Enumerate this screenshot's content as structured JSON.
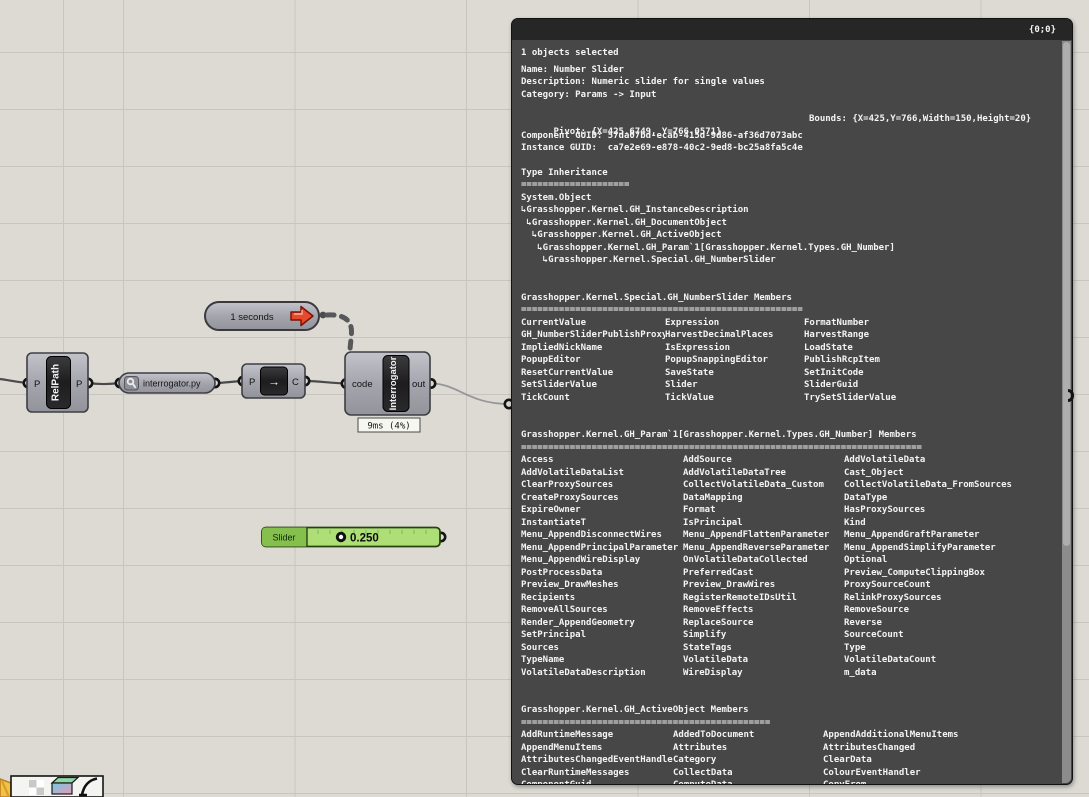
{
  "canvas": {
    "components": {
      "relpath": {
        "label": "RelPath",
        "input": "P",
        "output": "P"
      },
      "py_capsule": {
        "label": "interrogator.py"
      },
      "ptoc": {
        "input": "P",
        "output": "C",
        "arrow": "→"
      },
      "interrogator": {
        "label": "Interrogator",
        "input": "code",
        "output": "out",
        "runtime": "9ms (4%)"
      },
      "timer": {
        "label": "1 seconds"
      },
      "slider": {
        "label": "Slider",
        "value": "0.250"
      }
    },
    "colors": {
      "canvas_bg": "#dcdad3",
      "grid_line": "#c7c5be",
      "component_gray": "#a9a9b1",
      "slider_green": "#aede76",
      "slider_label_green": "#85c04f",
      "timer_arrow_red": "#e8492c",
      "panel_bg": "#474747",
      "panel_header_bg": "#262626"
    }
  },
  "panel": {
    "path_badge": "{0;0}",
    "selected": "1 objects selected",
    "name": "Name: Number Slider",
    "description": "Description: Numeric slider for single values",
    "category": "Category: Params -> Input",
    "pivot": "Pivot: {X=425.6749, Y=766.0571}",
    "bounds": "Bounds: {X=425,Y=766,Width=150,Height=20}",
    "component_guid": "Component GUID: 57da07bd-ecab-415d-9d86-af36d7073abc",
    "instance_guid": "Instance GUID:  ca7e2e69-e878-40c2-9ed8-bc25a8fa5c4e",
    "inheritance": {
      "title": "Type Inheritance",
      "sep": "====================",
      "lines": [
        "System.Object",
        "↳Grasshopper.Kernel.GH_InstanceDescription",
        " ↳Grasshopper.Kernel.GH_DocumentObject",
        "  ↳Grasshopper.Kernel.GH_ActiveObject",
        "   ↳Grasshopper.Kernel.GH_Param`1[Grasshopper.Kernel.Types.GH_Number]",
        "    ↳Grasshopper.Kernel.Special.GH_NumberSlider"
      ]
    },
    "sections": [
      {
        "title": "Grasshopper.Kernel.Special.GH_NumberSlider Members",
        "sep": "====================================================",
        "rows": [
          [
            "CurrentValue",
            "Expression",
            "FormatNumber"
          ],
          [
            "GH_NumberSliderPublishProxy",
            "HarvestDecimalPlaces",
            "HarvestRange"
          ],
          [
            "ImpliedNickName",
            "IsExpression",
            "LoadState"
          ],
          [
            "PopupEditor",
            "PopupSnappingEditor",
            "PublishRcpItem"
          ],
          [
            "ResetCurrentValue",
            "SaveState",
            "SetInitCode"
          ],
          [
            "SetSliderValue",
            "Slider",
            "SliderGuid"
          ],
          [
            "TickCount",
            "TickValue",
            "TrySetSliderValue"
          ]
        ]
      },
      {
        "title": "Grasshopper.Kernel.GH_Param`1[Grasshopper.Kernel.Types.GH_Number] Members",
        "sep": "==========================================================================",
        "rows": [
          [
            "Access",
            "AddSource",
            "AddVolatileData"
          ],
          [
            "AddVolatileDataList",
            "AddVolatileDataTree",
            "Cast_Object"
          ],
          [
            "ClearProxySources",
            "CollectVolatileData_Custom",
            "CollectVolatileData_FromSources"
          ],
          [
            "CreateProxySources",
            "DataMapping",
            "DataType"
          ],
          [
            "ExpireOwner",
            "Format",
            "HasProxySources"
          ],
          [
            "InstantiateT",
            "IsPrincipal",
            "Kind"
          ],
          [
            "Menu_AppendDisconnectWires",
            "Menu_AppendFlattenParameter",
            "Menu_AppendGraftParameter"
          ],
          [
            "Menu_AppendPrincipalParameter",
            "Menu_AppendReverseParameter",
            "Menu_AppendSimplifyParameter"
          ],
          [
            "Menu_AppendWireDisplay",
            "OnVolatileDataCollected",
            "Optional"
          ],
          [
            "PostProcessData",
            "PreferredCast",
            "Preview_ComputeClippingBox"
          ],
          [
            "Preview_DrawMeshes",
            "Preview_DrawWires",
            "ProxySourceCount"
          ],
          [
            "Recipients",
            "RegisterRemoteIDsUtil",
            "RelinkProxySources"
          ],
          [
            "RemoveAllSources",
            "RemoveEffects",
            "RemoveSource"
          ],
          [
            "Render_AppendGeometry",
            "ReplaceSource",
            "Reverse"
          ],
          [
            "SetPrincipal",
            "Simplify",
            "SourceCount"
          ],
          [
            "Sources",
            "StateTags",
            "Type"
          ],
          [
            "TypeName",
            "VolatileData",
            "VolatileDataCount"
          ],
          [
            "VolatileDataDescription",
            "WireDisplay",
            "m_data"
          ]
        ]
      },
      {
        "title": "Grasshopper.Kernel.GH_ActiveObject Members",
        "sep": "==============================================",
        "rows": [
          [
            "AddRuntimeMessage",
            "AddedToDocument",
            "AppendAdditionalMenuItems"
          ],
          [
            "AppendMenuItems",
            "Attributes",
            "AttributesChanged"
          ],
          [
            "AttributesChangedEventHandler",
            "Category",
            "ClearData"
          ],
          [
            "ClearRuntimeMessages",
            "CollectData",
            "ColourEventHandler"
          ],
          [
            "ComponentGuid",
            "ComputeData",
            "CopyFrom"
          ]
        ]
      }
    ]
  }
}
